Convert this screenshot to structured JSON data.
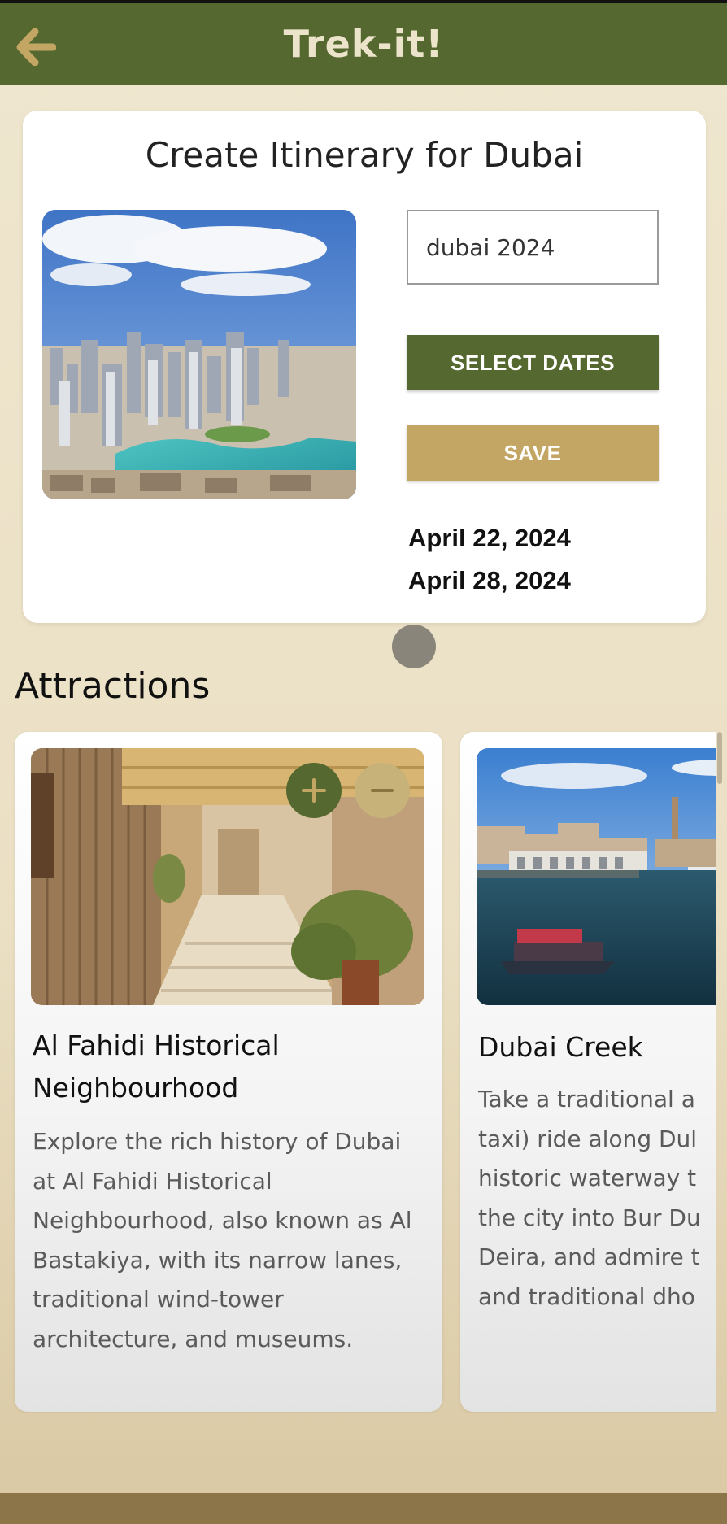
{
  "appbar": {
    "title": "Trek-it!",
    "back_icon": "arrow-left-icon",
    "colors": {
      "bar": "#55682f",
      "title": "#ece3cb",
      "accent": "#c4a664"
    }
  },
  "create": {
    "title": "Create Itinerary for Dubai",
    "name_value": "dubai 2024",
    "select_dates_label": "SELECT DATES",
    "save_label": "SAVE",
    "start_date": "April 22, 2024",
    "end_date": "April 28, 2024"
  },
  "attractions": {
    "heading": "Attractions",
    "items": [
      {
        "name": "Al Fahidi Historical Neighbourhood",
        "description": "Explore the rich history of Dubai at Al Fahidi Historical Neighbourhood, also known as Al Bastakiya, with its narrow lanes, traditional wind-tower architecture, and museums.",
        "add_icon": "plus-icon",
        "remove_icon": "minus-icon"
      },
      {
        "name": "Dubai Creek",
        "description_lines": [
          "Take a traditional a",
          "taxi) ride along Dul",
          "historic waterway t",
          "the city into Bur Du",
          "Deira, and admire t",
          "and traditional dho"
        ]
      }
    ]
  }
}
